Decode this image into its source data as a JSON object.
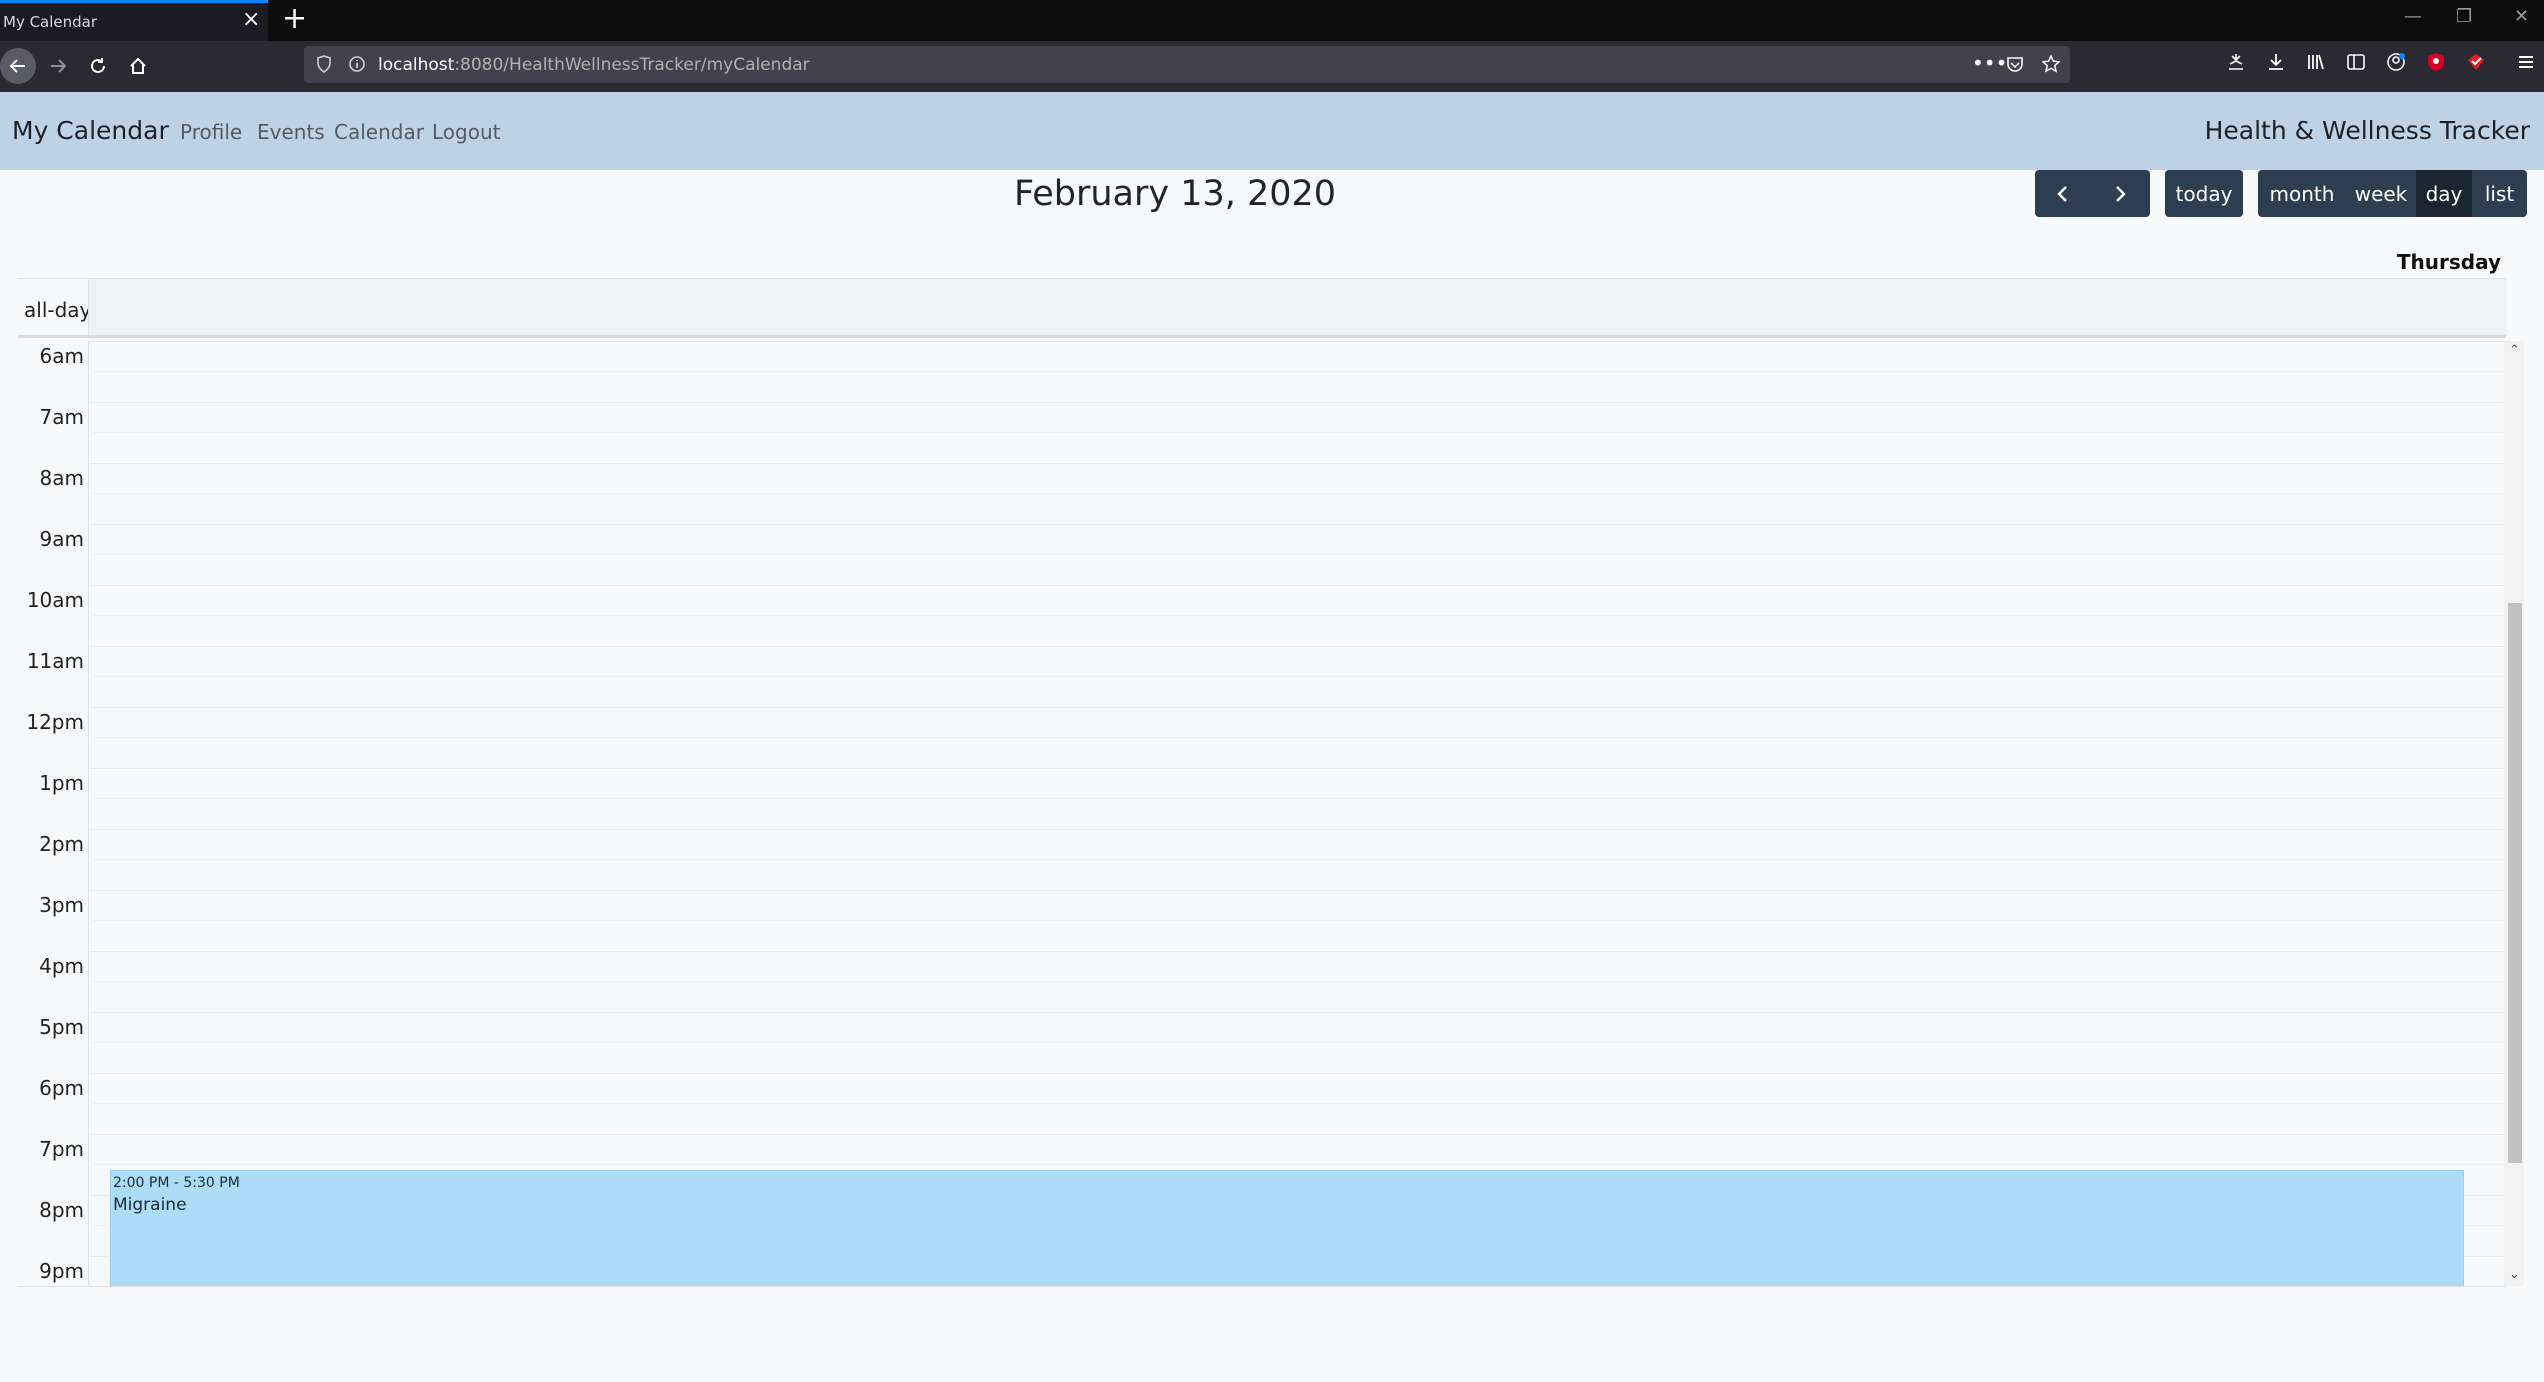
{
  "browser": {
    "tab_title": "My Calendar",
    "url_host": "localhost",
    "url_path": ":8080/HealthWellnessTracker/myCalendar",
    "icons": [
      "back-icon",
      "forward-icon",
      "reload-icon",
      "home-icon",
      "shield-icon",
      "info-icon",
      "more-icon",
      "pocket-icon",
      "star-icon",
      "library-icon",
      "downloads-icon",
      "bookmarks-icon",
      "sidebar-icon",
      "account-icon",
      "extension-icon",
      "menu-icon"
    ]
  },
  "header": {
    "brand": "My Calendar",
    "nav": [
      "Profile",
      "Events",
      "Calendar",
      "Logout"
    ],
    "app_name": "Health & Wellness Tracker",
    "background": "#bed2e6"
  },
  "calendar": {
    "title": "February 13, 2020",
    "toolbar": {
      "prev": "‹",
      "next": "›",
      "today": "today",
      "views": [
        "month",
        "week",
        "day",
        "list"
      ],
      "active_view": "day"
    },
    "day_header": "Thursday",
    "all_day_label": "all-day",
    "time_labels": [
      "6am",
      "7am",
      "8am",
      "9am",
      "10am",
      "11am",
      "12pm",
      "1pm",
      "2pm",
      "3pm",
      "4pm",
      "5pm",
      "6pm",
      "7pm",
      "8pm",
      "9pm"
    ],
    "event": {
      "time": "2:00 PM - 5:30 PM",
      "title": "Migraine",
      "color": "#acdcf7",
      "resizer": "="
    },
    "button_color": "#2c3e50"
  }
}
